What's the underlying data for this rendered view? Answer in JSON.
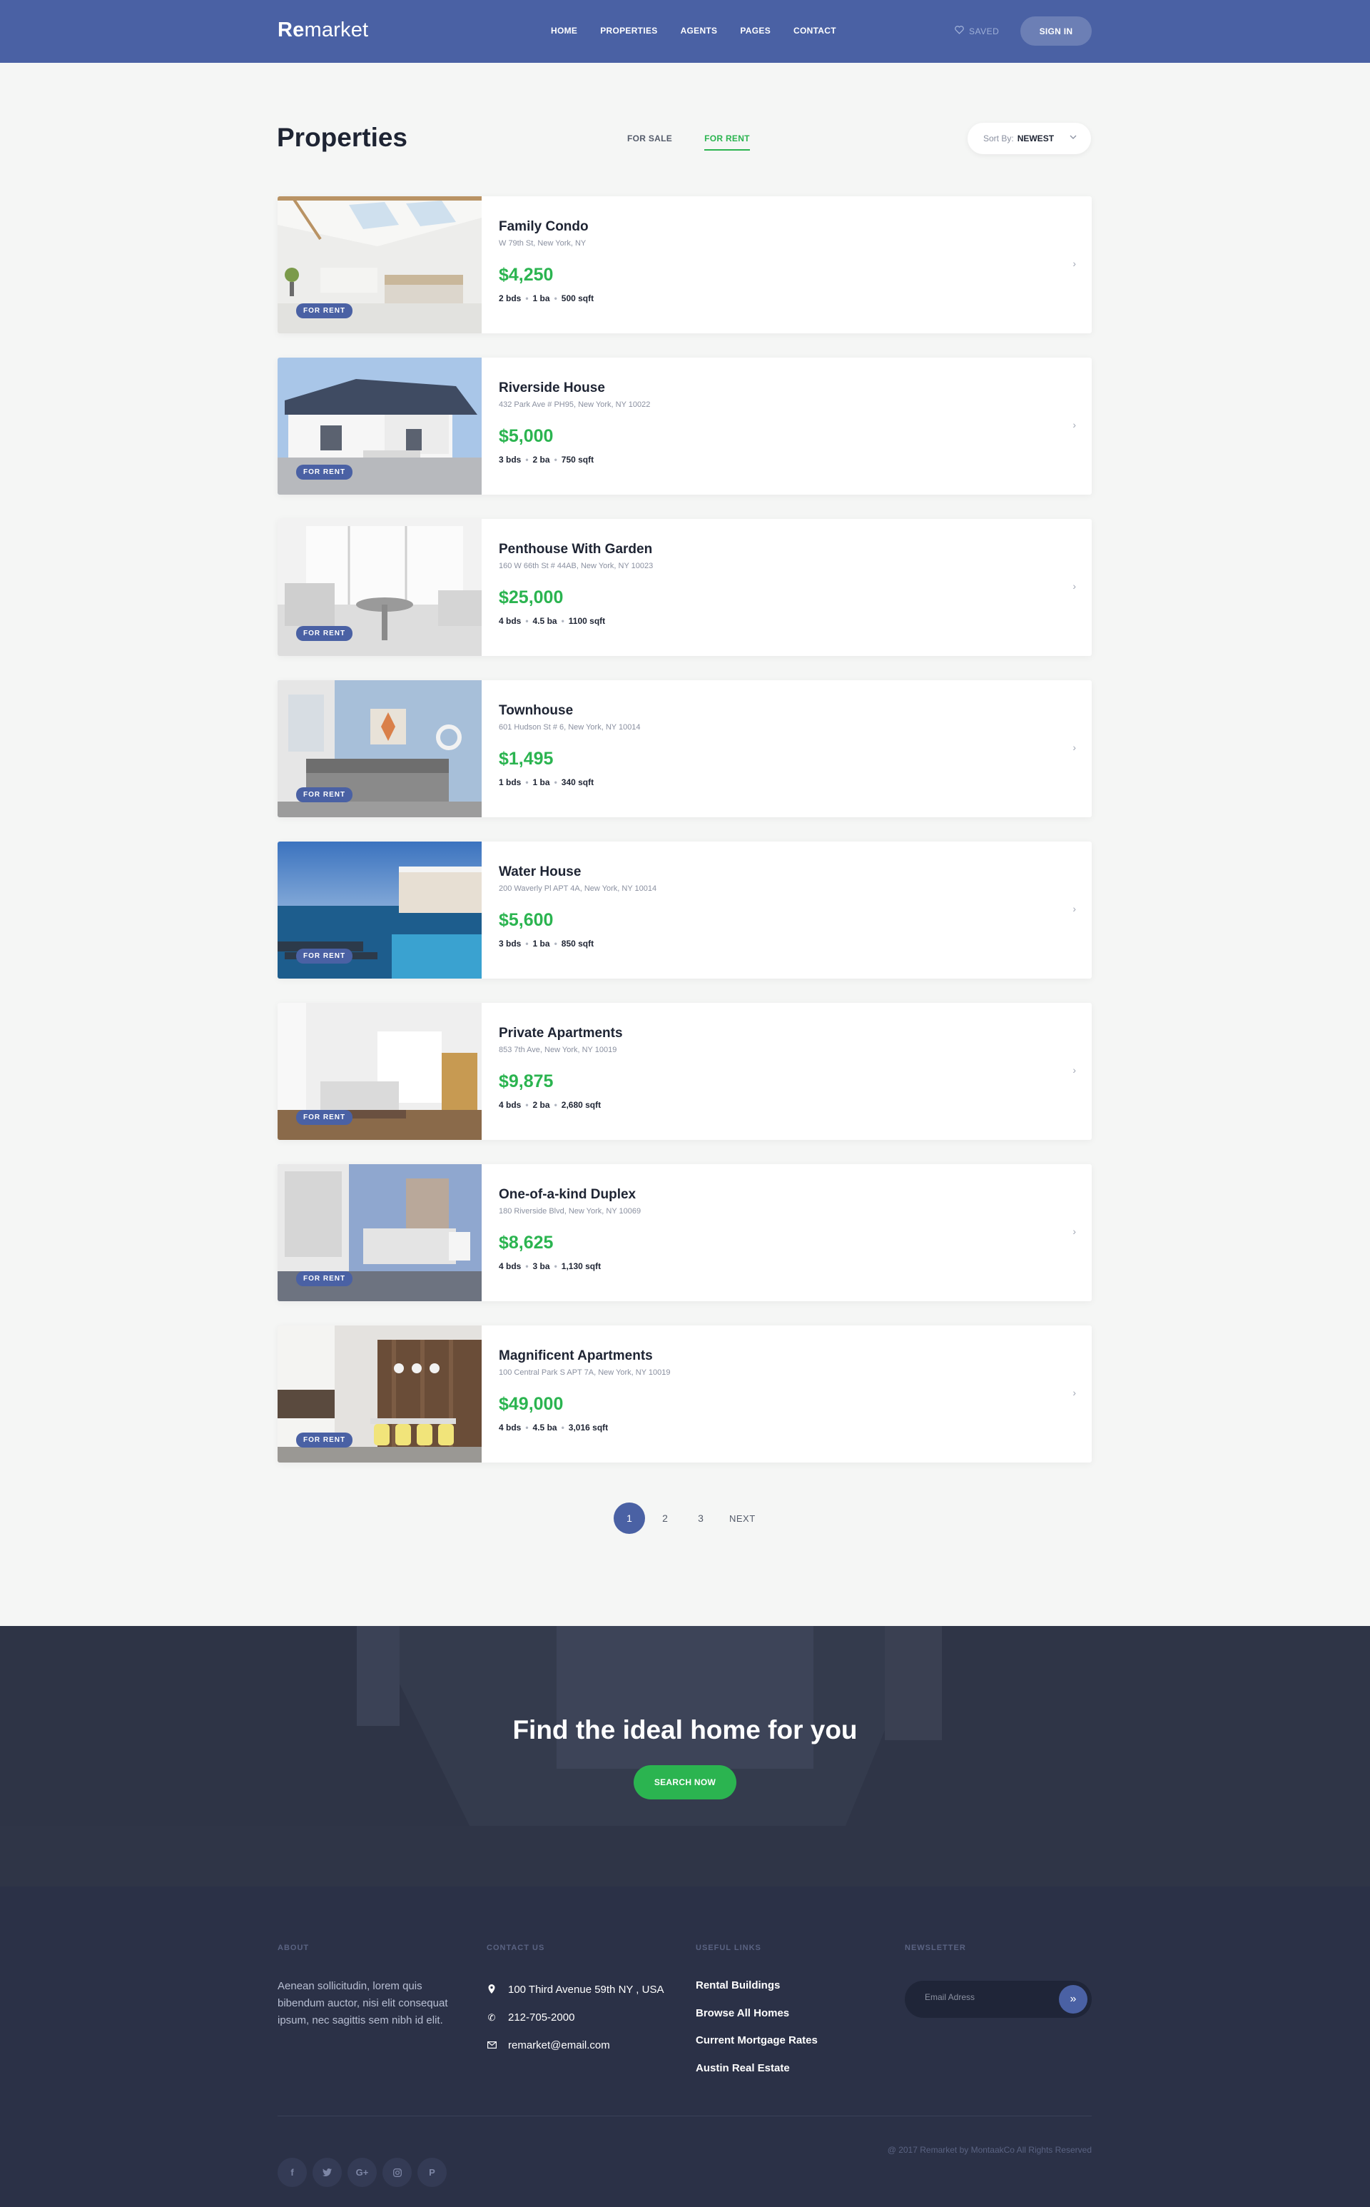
{
  "header": {
    "logo_bold": "Re",
    "logo_rest": "market",
    "nav": [
      "HOME",
      "PROPERTIES",
      "AGENTS",
      "PAGES",
      "CONTACT"
    ],
    "saved_label": "SAVED",
    "signin_label": "SIGN IN"
  },
  "main": {
    "title": "Properties",
    "tabs": [
      "FOR SALE",
      "FOR RENT"
    ],
    "active_tab": "FOR RENT",
    "sort_label": "Sort By:",
    "sort_value": "NEWEST"
  },
  "listings": [
    {
      "name": "Family Condo",
      "address": "W 79th St, New York, NY",
      "price": "$4,250",
      "beds": "2 bds",
      "baths": "1 ba",
      "area": "500 sqft",
      "badge": "FOR RENT"
    },
    {
      "name": "Riverside House",
      "address": "432 Park Ave # PH95, New York, NY 10022",
      "price": "$5,000",
      "beds": "3 bds",
      "baths": "2 ba",
      "area": "750 sqft",
      "badge": "FOR RENT"
    },
    {
      "name": "Penthouse With Garden",
      "address": "160 W 66th St # 44AB, New York, NY 10023",
      "price": "$25,000",
      "beds": "4 bds",
      "baths": "4.5 ba",
      "area": "1100 sqft",
      "badge": "FOR RENT"
    },
    {
      "name": "Townhouse",
      "address": "601 Hudson St # 6, New York, NY 10014",
      "price": "$1,495",
      "beds": "1 bds",
      "baths": "1 ba",
      "area": "340 sqft",
      "badge": "FOR RENT"
    },
    {
      "name": "Water House",
      "address": "200 Waverly Pl APT 4A, New York, NY 10014",
      "price": "$5,600",
      "beds": "3 bds",
      "baths": "1 ba",
      "area": "850 sqft",
      "badge": "FOR RENT"
    },
    {
      "name": "Private Apartments",
      "address": "853 7th Ave, New York, NY 10019",
      "price": "$9,875",
      "beds": "4 bds",
      "baths": "2 ba",
      "area": "2,680 sqft",
      "badge": "FOR RENT"
    },
    {
      "name": "One-of-a-kind Duplex",
      "address": "180 Riverside Blvd, New York, NY 10069",
      "price": "$8,625",
      "beds": "4 bds",
      "baths": "3 ba",
      "area": "1,130 sqft",
      "badge": "FOR RENT"
    },
    {
      "name": "Magnificent Apartments",
      "address": "100 Central Park S APT 7A, New York, NY 10019",
      "price": "$49,000",
      "beds": "4 bds",
      "baths": "4.5 ba",
      "area": "3,016 sqft",
      "badge": "FOR RENT"
    }
  ],
  "pagination": {
    "pages": [
      "1",
      "2",
      "3"
    ],
    "active": "1",
    "next_label": "NEXT"
  },
  "cta": {
    "title": "Find the ideal home for you",
    "button": "SEARCH NOW"
  },
  "footer": {
    "about_title": "ABOUT",
    "about_text": "Aenean sollicitudin, lorem quis bibendum auctor, nisi elit consequat ipsum, nec sagittis sem nibh id elit.",
    "contact_title": "CONTACT US",
    "address": "100 Third Avenue 59th NY , USA",
    "phone": "212-705-2000",
    "email": "remarket@email.com",
    "links_title": "USEFUL LINKS",
    "links": [
      "Rental Buildings",
      "Browse All Homes",
      "Current Mortgage Rates",
      "Austin Real Estate"
    ],
    "newsletter_title": "NEWSLETTER",
    "newsletter_placeholder": "Email Adress",
    "socials": [
      "facebook-icon",
      "twitter-icon",
      "google-plus-icon",
      "instagram-icon",
      "pinterest-icon"
    ],
    "copyright": "@ 2017 Remarket by MontaakCo All Rights Reserved"
  },
  "colors": {
    "brand": "#4a61a4",
    "accent_green": "#2bb450",
    "footer_bg": "#2b3147"
  }
}
